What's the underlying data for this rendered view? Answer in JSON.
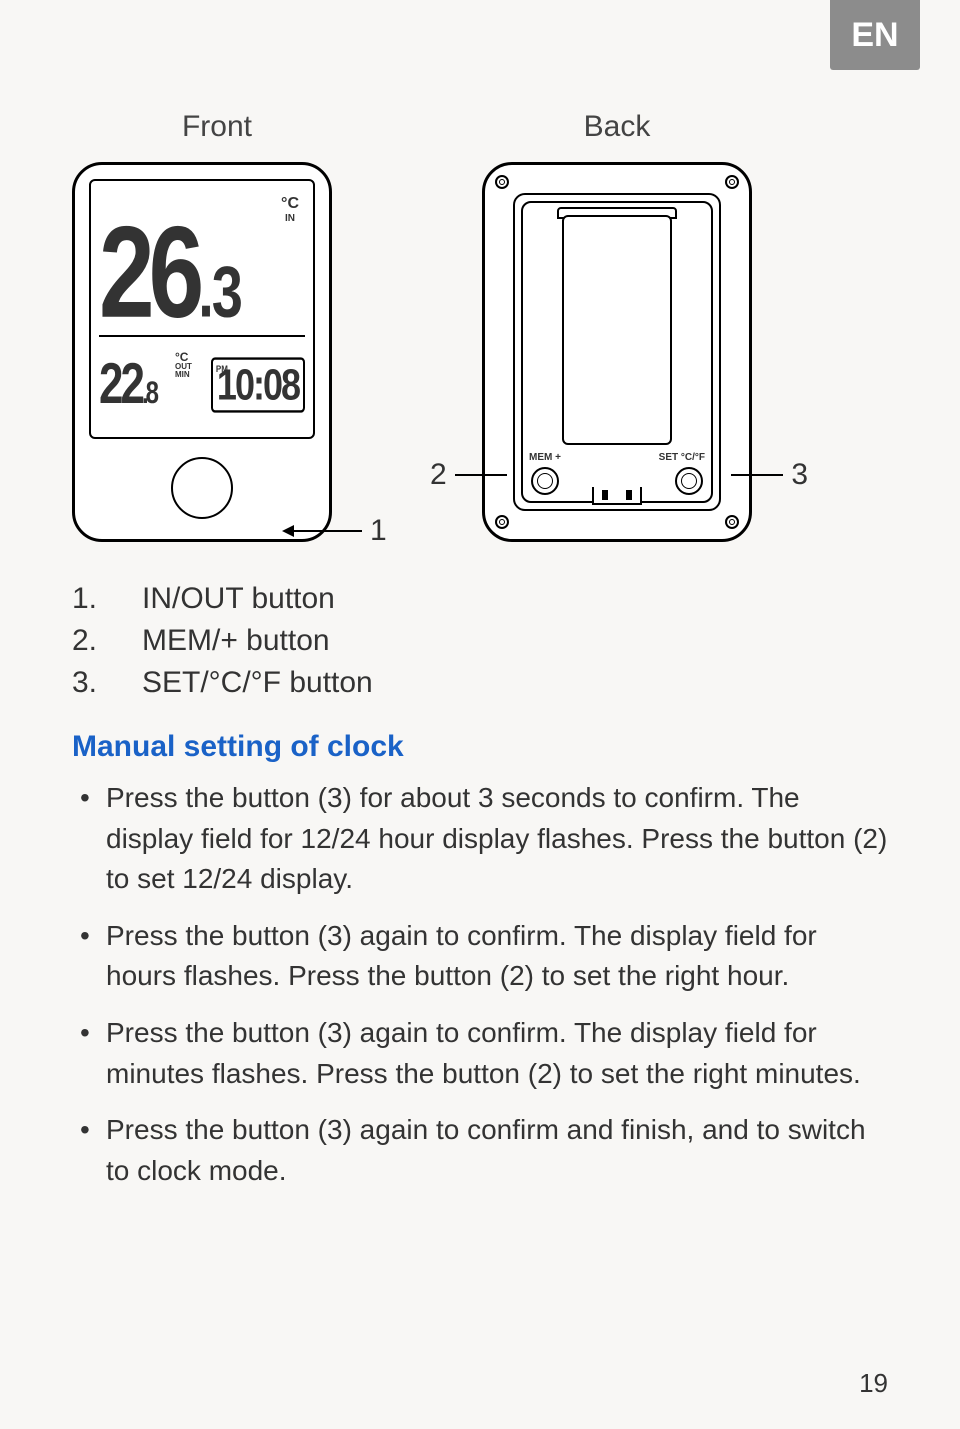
{
  "lang_tab": "EN",
  "diagram": {
    "front_label": "Front",
    "back_label": "Back",
    "front": {
      "main_temp_int": "26",
      "main_temp_dec": ".3",
      "main_unit": "°C",
      "main_in": "IN",
      "out_temp_int": "22",
      "out_temp_dec": ".8",
      "out_unit": "°C",
      "out_label": "OUT",
      "out_min": "MIN",
      "clock_pm": "PM",
      "clock_time": "10:08"
    },
    "back": {
      "mem_label": "MEM\n+",
      "set_label": "SET\n°C/°F"
    },
    "callouts": {
      "c1": "1",
      "c2": "2",
      "c3": "3"
    }
  },
  "legend": [
    {
      "n": "1.",
      "text": "IN/OUT button"
    },
    {
      "n": "2.",
      "text": "MEM/+ button"
    },
    {
      "n": "3.",
      "text": "SET/°C/°F button"
    }
  ],
  "section_title": "Manual setting of clock",
  "instructions": [
    "Press the button (3) for about 3 seconds to confirm. The display field for 12/24 hour display flashes. Press the button (2) to set 12/24 display.",
    "Press the button (3) again to confirm. The display field for hours flashes. Press the button (2) to set the right hour.",
    "Press the button (3) again to confirm. The display field for minutes flashes. Press the button (2) to set the right minutes.",
    "Press the button (3) again to confirm and finish, and to switch to clock mode."
  ],
  "page_number": "19"
}
